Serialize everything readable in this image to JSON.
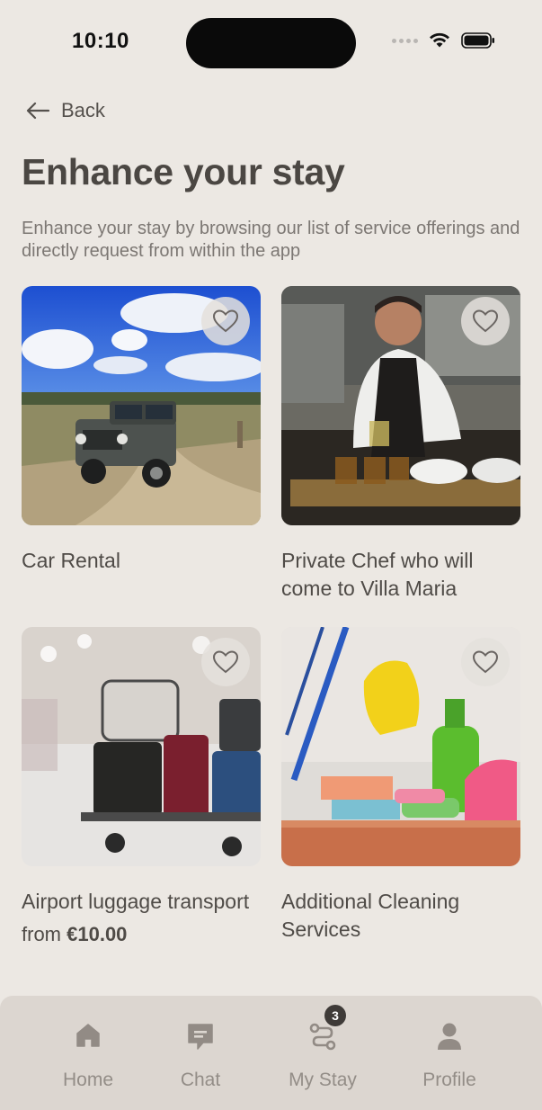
{
  "status_bar": {
    "time": "10:10"
  },
  "header": {
    "back_label": "Back",
    "title": "Enhance your stay",
    "subtitle": "Enhance your stay by browsing our list of service offerings and directly request from within the app"
  },
  "services": [
    {
      "title": "Car Rental",
      "price_prefix": "",
      "price": ""
    },
    {
      "title": "Private Chef who will come to Villa Maria",
      "price_prefix": "",
      "price": ""
    },
    {
      "title": "Airport luggage transport",
      "price_prefix": "from ",
      "price": "€10.00"
    },
    {
      "title": "Additional Cleaning Services",
      "price_prefix": "",
      "price": ""
    }
  ],
  "bottom_nav": {
    "items": [
      {
        "label": "Home",
        "icon": "home-icon"
      },
      {
        "label": "Chat",
        "icon": "chat-icon"
      },
      {
        "label": "My Stay",
        "icon": "route-icon",
        "badge": "3"
      },
      {
        "label": "Profile",
        "icon": "profile-icon"
      }
    ]
  },
  "colors": {
    "background": "#ece8e3",
    "nav_background": "#dcd6d0",
    "text": "#4b4743",
    "muted": "#7c7773"
  }
}
